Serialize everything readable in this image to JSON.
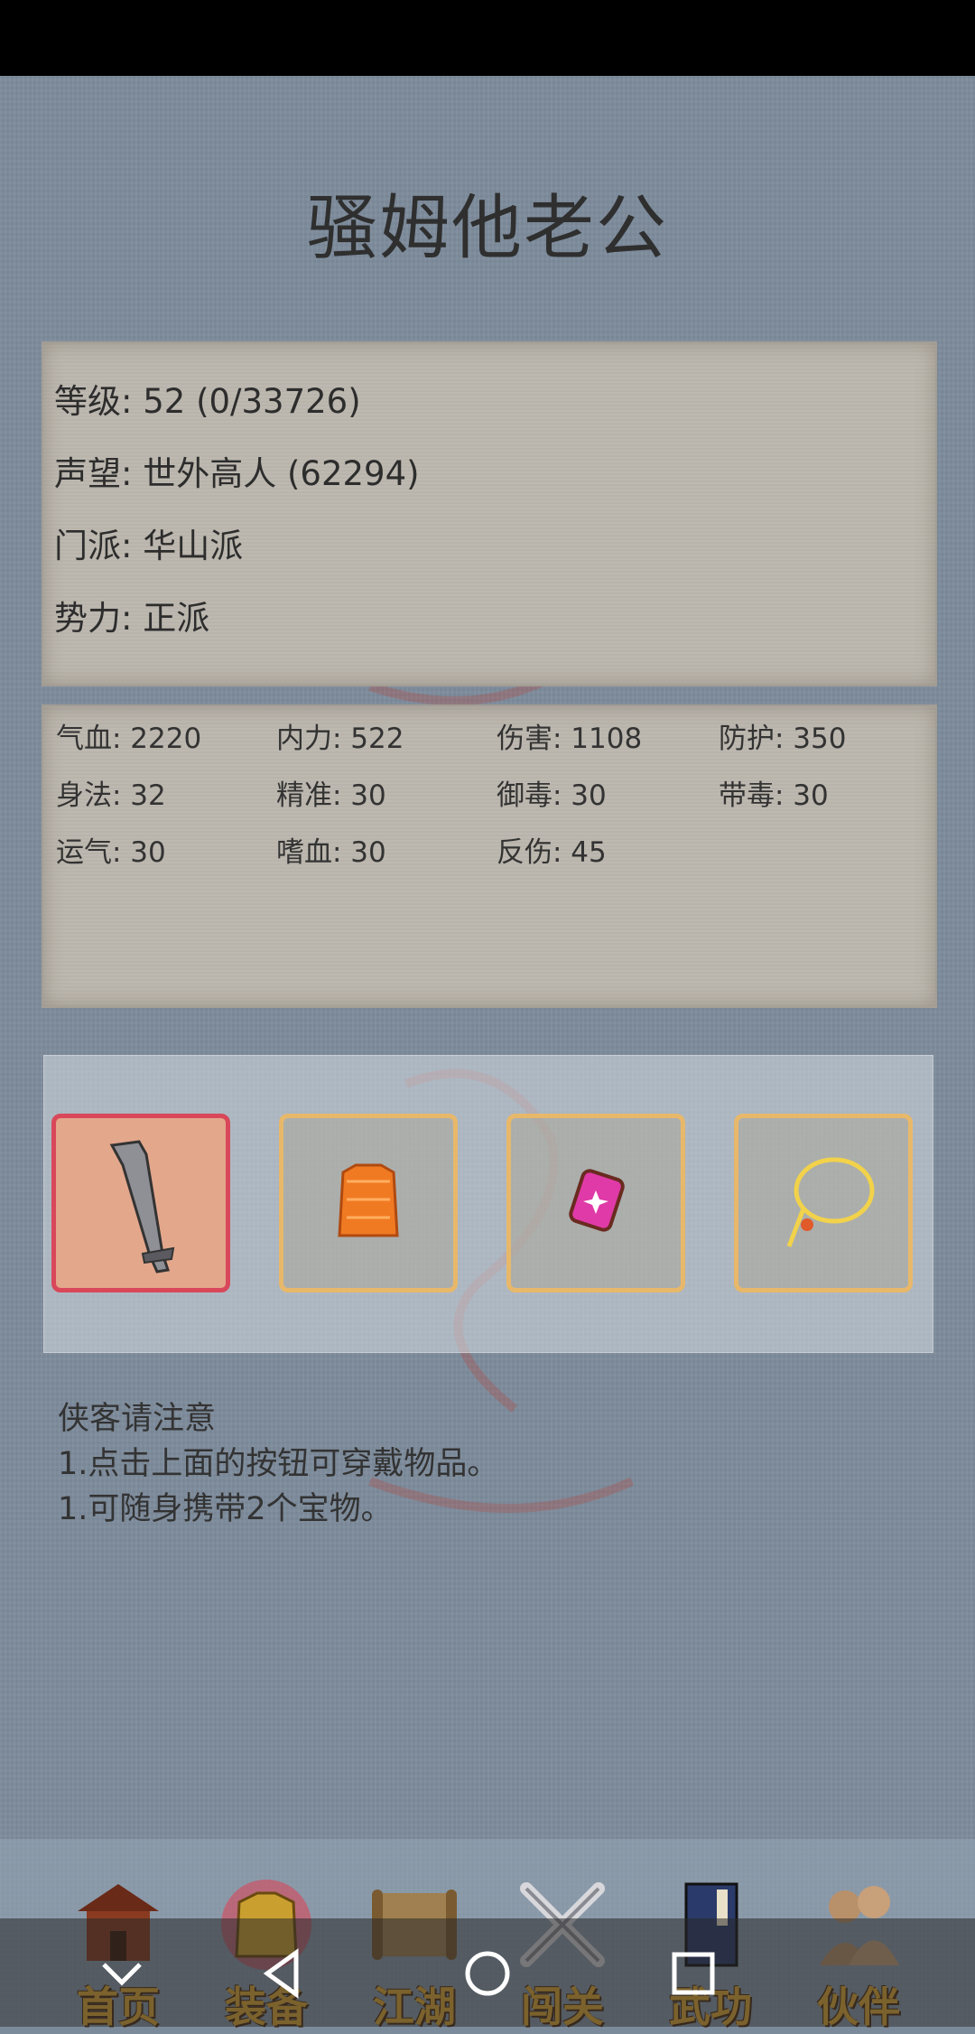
{
  "title": "骚姆他老公",
  "info": {
    "level": "等级: 52 (0/33726)",
    "reputation": "声望: 世外高人 (62294)",
    "sect": "门派: 华山派",
    "faction": "势力:  正派"
  },
  "stats": [
    {
      "label": "气血: 2220"
    },
    {
      "label": "内力: 522"
    },
    {
      "label": "伤害: 1108"
    },
    {
      "label": "防护: 350"
    },
    {
      "label": "身法: 32"
    },
    {
      "label": "精准: 30"
    },
    {
      "label": "御毒: 30"
    },
    {
      "label": "带毒: 30"
    },
    {
      "label": "运气: 30"
    },
    {
      "label": "嗜血: 30"
    },
    {
      "label": "反伤: 45"
    }
  ],
  "equipment": [
    {
      "icon": "sword-icon",
      "active": true
    },
    {
      "icon": "armor-icon",
      "active": false
    },
    {
      "icon": "gem-icon",
      "active": false
    },
    {
      "icon": "necklace-icon",
      "active": false
    }
  ],
  "notice": {
    "title": "侠客请注意",
    "line1": "1.点击上面的按钮可穿戴物品。",
    "line2": "1.可随身携带2个宝物。"
  },
  "nav": [
    {
      "label": "首页",
      "icon": "temple-icon"
    },
    {
      "label": "装备",
      "icon": "armor-icon"
    },
    {
      "label": "江湖",
      "icon": "scroll-icon"
    },
    {
      "label": "闯关",
      "icon": "crossed-swords-icon"
    },
    {
      "label": "武功",
      "icon": "book-icon"
    },
    {
      "label": "伙伴",
      "icon": "partners-icon"
    }
  ],
  "colors": {
    "background": "#7d8c9c",
    "panel": "#bcb7ae",
    "slot_border": "#e8b86a",
    "slot_active_border": "#d9475a",
    "nav_label": "#e0a834"
  }
}
